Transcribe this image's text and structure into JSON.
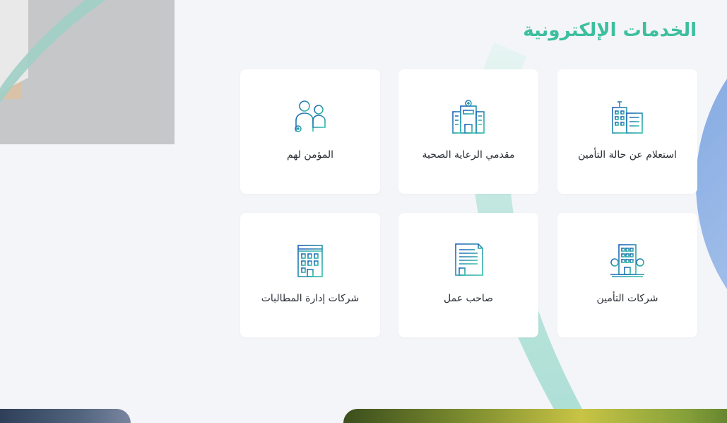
{
  "section": {
    "title": "الخدمات الإلكترونية"
  },
  "services": [
    {
      "label": "استعلام عن حالة التأمين",
      "icon": "insurance-building-icon"
    },
    {
      "label": "مقدمي الرعاية الصحية",
      "icon": "hospital-icon"
    },
    {
      "label": "المؤمن لهم",
      "icon": "insured-people-icon"
    },
    {
      "label": "شركات التأمين",
      "icon": "insurance-company-icon"
    },
    {
      "label": "صاحب عمل",
      "icon": "employer-document-icon"
    },
    {
      "label": "شركات إدارة المطالبات",
      "icon": "claims-company-building-icon"
    }
  ],
  "colors": {
    "accent": "#3dbf9f",
    "icon_blue": "#1e5fb8",
    "icon_teal": "#33c2a5",
    "background": "#f4f5f9"
  }
}
